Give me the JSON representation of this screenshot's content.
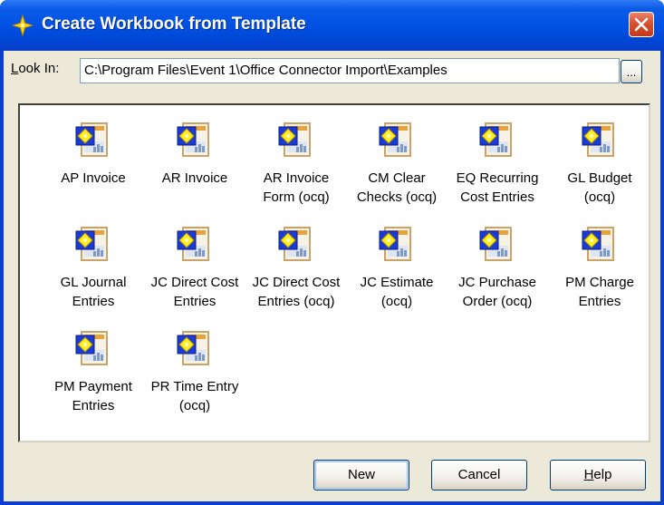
{
  "window": {
    "title": "Create Workbook from Template",
    "close_icon": "close-icon"
  },
  "lookin": {
    "label_first": "L",
    "label_rest": "ook In:",
    "value": "C:\\Program Files\\Event 1\\Office Connector Import\\Examples",
    "browse_label": "..."
  },
  "items": [
    {
      "line1": "AP Invoice",
      "line2": ""
    },
    {
      "line1": "AR Invoice",
      "line2": ""
    },
    {
      "line1": "AR Invoice",
      "line2": "Form (ocq)"
    },
    {
      "line1": "CM Clear",
      "line2": "Checks (ocq)"
    },
    {
      "line1": "EQ Recurring",
      "line2": "Cost Entries"
    },
    {
      "line1": "GL Budget",
      "line2": "(ocq)"
    },
    {
      "line1": "GL Journal",
      "line2": "Entries"
    },
    {
      "line1": "JC Direct Cost",
      "line2": "Entries"
    },
    {
      "line1": "JC Direct Cost",
      "line2": "Entries (ocq)"
    },
    {
      "line1": "JC Estimate",
      "line2": "(ocq)"
    },
    {
      "line1": "JC Purchase",
      "line2": "Order (ocq)"
    },
    {
      "line1": "PM Charge",
      "line2": "Entries"
    },
    {
      "line1": "PM Payment",
      "line2": "Entries"
    },
    {
      "line1": "PR Time Entry",
      "line2": "(ocq)"
    }
  ],
  "buttons": {
    "new_label": "New",
    "cancel_label": "Cancel",
    "help_first": "H",
    "help_rest": "elp"
  },
  "colors": {
    "titlebar": "#0052e3",
    "close": "#d9502e",
    "dialog_bg": "#ece9d8"
  }
}
